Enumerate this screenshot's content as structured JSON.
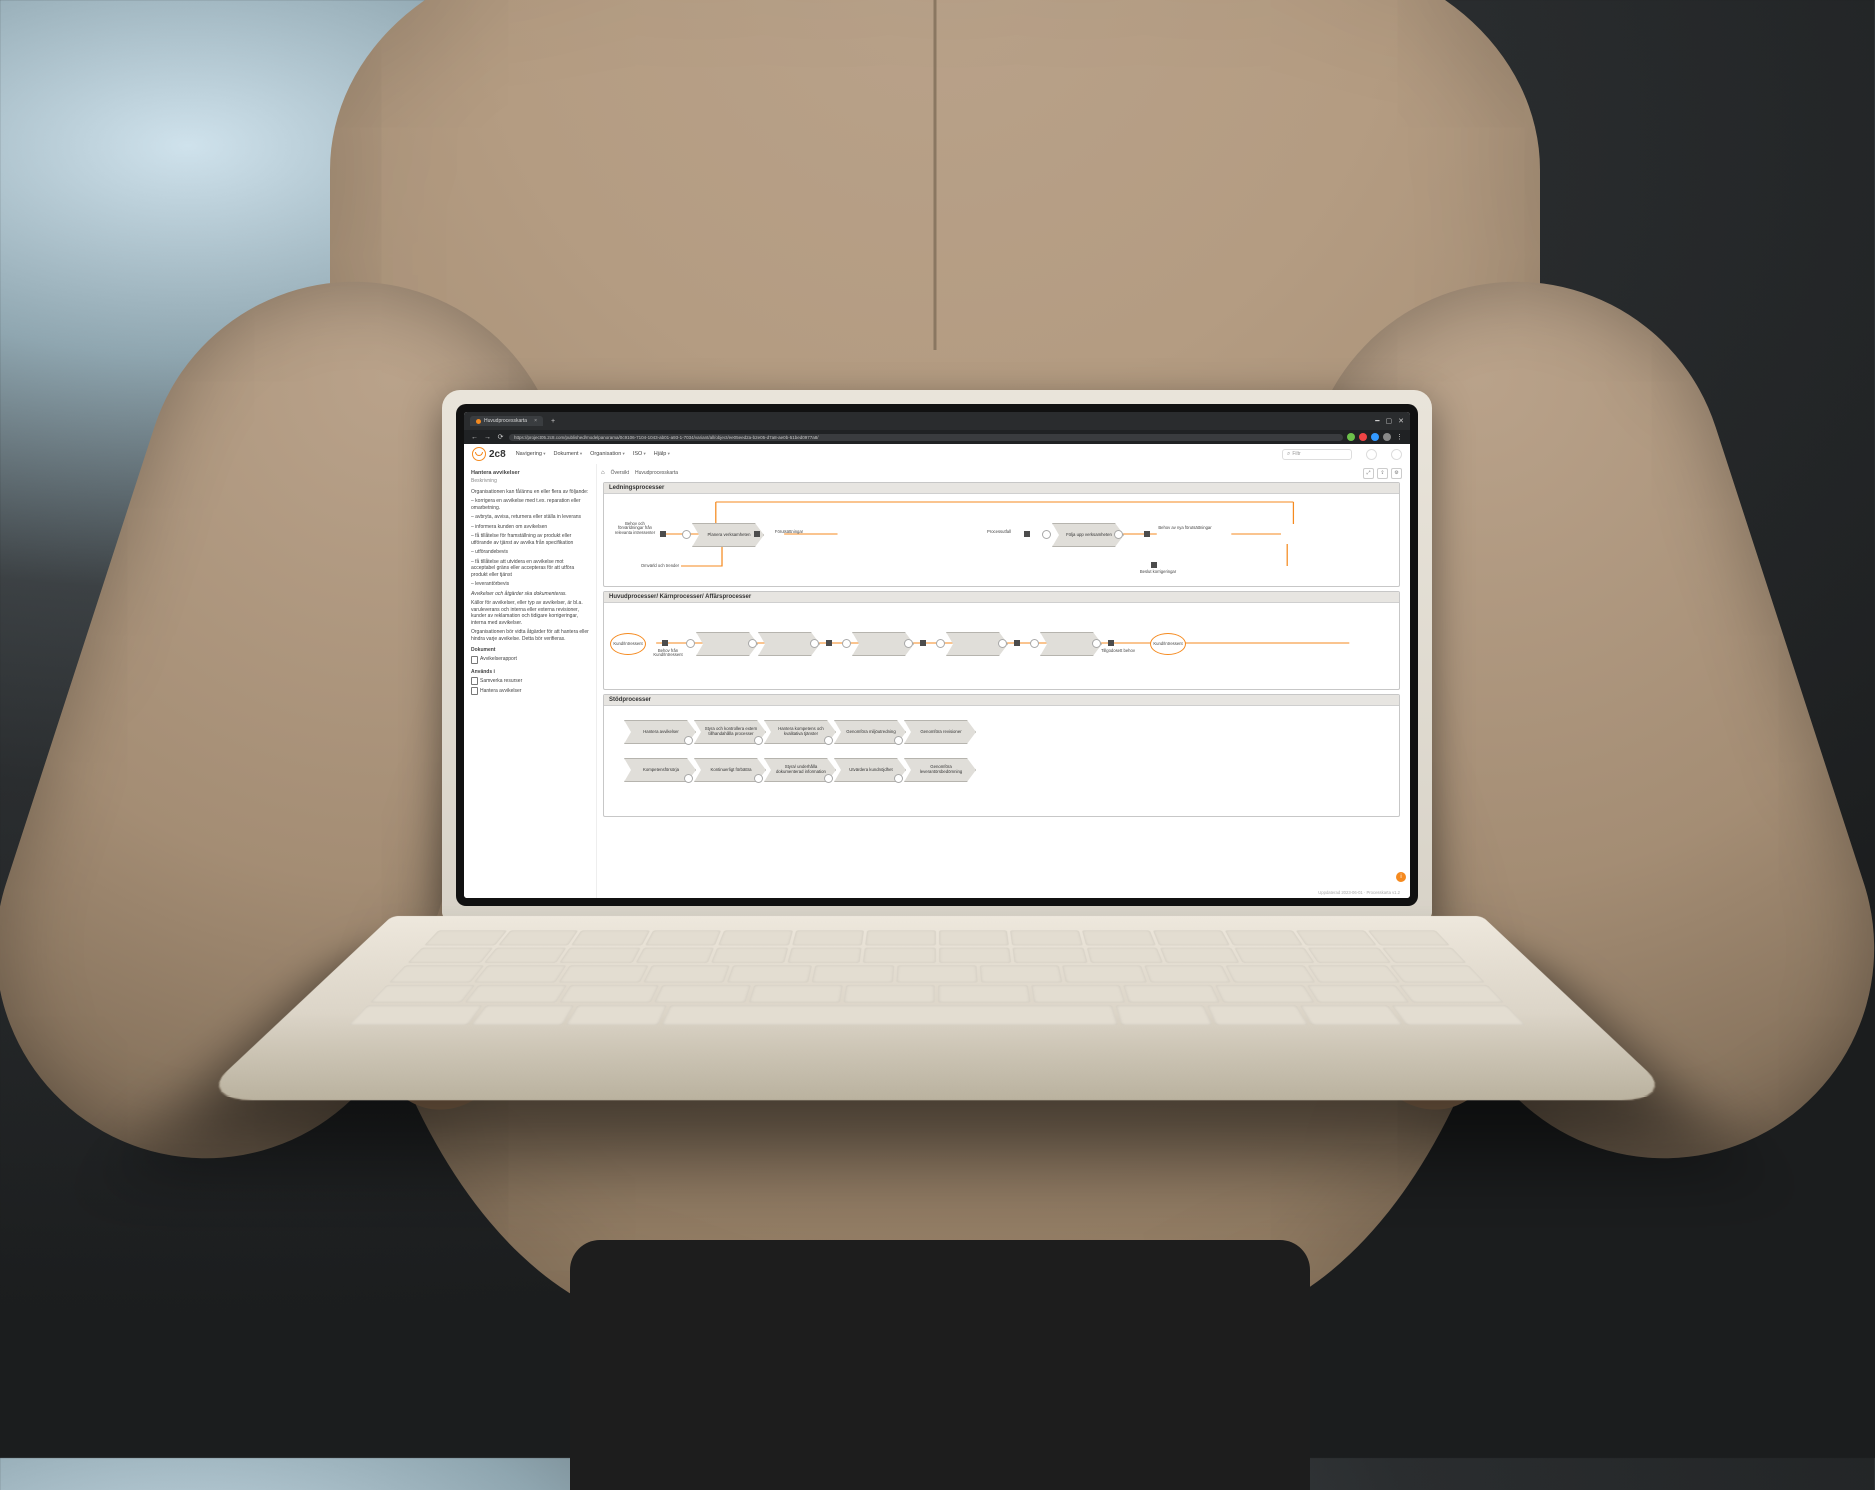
{
  "browser": {
    "tab_title": "Huvudprocesskarta",
    "url": "https://project05.2c8.com/published/modelpanorama/0c9106-7104-1043-ab01-a93-1-7034/variant/all/object/ee05eed2a-b2e05-d7a8-ae0b-51bed0977a8/"
  },
  "app": {
    "brand": "2c8",
    "menus": [
      "Navigering",
      "Dokument",
      "Organisation",
      "ISO",
      "Hjälp"
    ],
    "search_placeholder": "Filtr"
  },
  "sidebar": {
    "title": "Hantera avvikelser",
    "subtitle": "Beskrivning",
    "intro": "Organisationen kan få/ännu en eller flera av följande:",
    "bullets": [
      "– korrigera en avvikelse med t.ex. reparation eller omarbetning.",
      "– avbryta, avvisa, returnera eller ställa in leverans",
      "– informera kunden om avvikelsen",
      "– få tillåtelse för framställning av produkt eller utförande av tjänst av avvika från specifikation",
      "– utförandebevis",
      "– få tillåtelse att utvidera en avvikelse mot acceptabel gräns eller accepteras för att utföra produkt eller tjänst",
      "– leverantörbevis"
    ],
    "note": "Avvikelser och åtgärder ska dokumenteras.",
    "body": "Källor för avvikelser, eller typ av avvikelser, är bl.a. varuleverans och interna eller externa revisioner, kunder av reklamation och tidigare korrigeringar, interna med avvikelser.",
    "body2": "Organisationen bör vidta åtgärder för att hantera eller hindra varje avvikelse. Detta bör verifieras.",
    "documents_header": "Dokument",
    "documents": [
      "Avvikelserapport"
    ],
    "anvands_header": "Används i",
    "anvands": [
      "Samverka resurser",
      "Hantera avvikelser"
    ]
  },
  "crumbs": [
    "Översikt",
    "Huvudprocesskarta"
  ],
  "lanes": {
    "l1": "Ledningsprocesser",
    "l2": "Huvudprocesser/ Kärnprocesser/ Affärsprocesser",
    "l3": "Stödprocesser"
  },
  "l1": {
    "trigger1": "Behov och förvärldningar från relevanta intressenter",
    "step1": "Planera verksamheten",
    "out1": "Förutsättningar",
    "trigger2": "Processutfall",
    "step2": "Följa upp verksamheten",
    "out2a": "Behov av nya förutsättningar",
    "out2b": "Beslut korrigeringar",
    "sub": "Omvärld och trender"
  },
  "l2": {
    "start": "Kund/Intressent",
    "trig": "Behov från Kund/Intressent",
    "end_trig": "Tillgodosett behov",
    "end": "Kund/Intressent"
  },
  "l3": {
    "row1": [
      "Hantera avvikelser",
      "Styra och kontrollera extern tillhandahålla processer",
      "Hantera kompetens och kvalitativa tjänster",
      "Genomföra miljöutredning",
      "Genomföra revisioner"
    ],
    "row2": [
      "Kompetensförsörja",
      "Kontinuerligt förbättra",
      "Styra/ underhålla dokumenterad information",
      "Utvärdera kundnöjdhet",
      "Genomföra leverantörsbedömning"
    ]
  },
  "footer": "Uppdaterad 2023-06-01 · Processkarta v1.2"
}
